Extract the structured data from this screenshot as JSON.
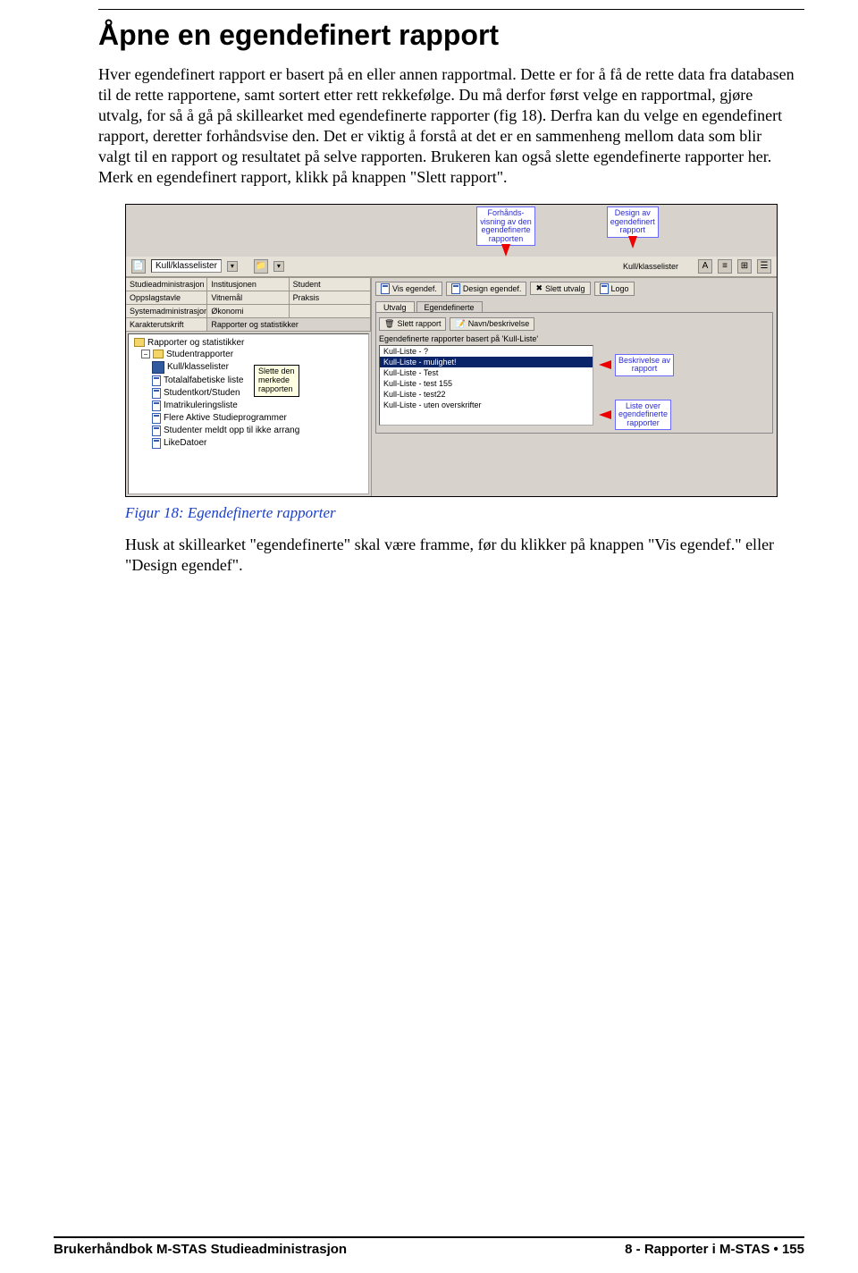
{
  "heading": "Åpne en egendefinert rapport",
  "paragraph": "Hver egendefinert rapport er basert på en eller annen rapportmal. Dette er for å få de rette data fra databasen til de rette rapportene, samt sortert etter rett rekkefølge. Du må derfor først velge en rapportmal, gjøre utvalg, for så å gå på skillearket med egendefinerte rapporter (fig 18). Derfra kan du velge en egendefinert rapport, deretter forhåndsvise den. Det er viktig å forstå at det er en sammenheng mellom data som blir valgt til en rapport og resultatet på selve rapporten. Brukeren kan også slette egendefinerte rapporter her. Merk en egendefinert rapport, klikk på knappen \"Slett rapport\".",
  "caption": "Figur 18: Egendefinerte rapporter",
  "after_text": "Husk at skillearket \"egendefinerte\" skal være framme, før du klikker på knappen \"Vis egendef.\" eller \"Design egendef\".",
  "toolbar": {
    "dropdown_value": "Kull/klasselister"
  },
  "callouts": {
    "preview": "Forhånds-\nvisning av den\negendefinerte\nrapporten",
    "design": "Design av\negendefinert\nrapport",
    "desc": "Beskrivelse av\nrapport",
    "list": "Liste over\negendefinerte\nrapporter"
  },
  "left_tabs": [
    "Studieadministrasjon",
    "Institusjonen",
    "Student",
    "Oppslagstavle",
    "Vitnemål",
    "Praksis",
    "Systemadministrasjon",
    "Økonomi",
    "",
    "Karakterutskrift",
    "Rapporter og statistikker",
    ""
  ],
  "tree": {
    "root": "Rapporter og statistikker",
    "folder": "Studentrapporter",
    "items": [
      "Kull/klasselister",
      "Totalalfabetiske liste",
      "Studentkort/Studen",
      "Imatrikuleringsliste",
      "Flere Aktive Studieprogrammer",
      "Studenter meldt opp til ikke arrang",
      "LikeDatoer"
    ]
  },
  "tooltip": "Slette den\nmerkede\nrapporten",
  "right_toolbar": {
    "vis": "Vis egendef.",
    "design": "Design egendef.",
    "slett_utv": "Slett utvalg",
    "logo": "Logo"
  },
  "small_tabs": {
    "utvalg": "Utvalg",
    "egendef": "Egendefinerte"
  },
  "panel": {
    "slett": "Slett rapport",
    "navn": "Navn/beskrivelse",
    "label": "Egendefinerte rapporter basert på 'Kull-Liste'",
    "items": [
      "Kull-Liste - ?",
      "Kull-Liste - mulighet!",
      "Kull-Liste - Test",
      "Kull-Liste - test 155",
      "Kull-Liste - test22",
      "Kull-Liste - uten overskrifter"
    ],
    "selected_index": 1
  },
  "footer": {
    "left": "Brukerhåndbok M-STAS Studieadministrasjon",
    "right": "8 - Rapporter i M-STAS • 155"
  }
}
